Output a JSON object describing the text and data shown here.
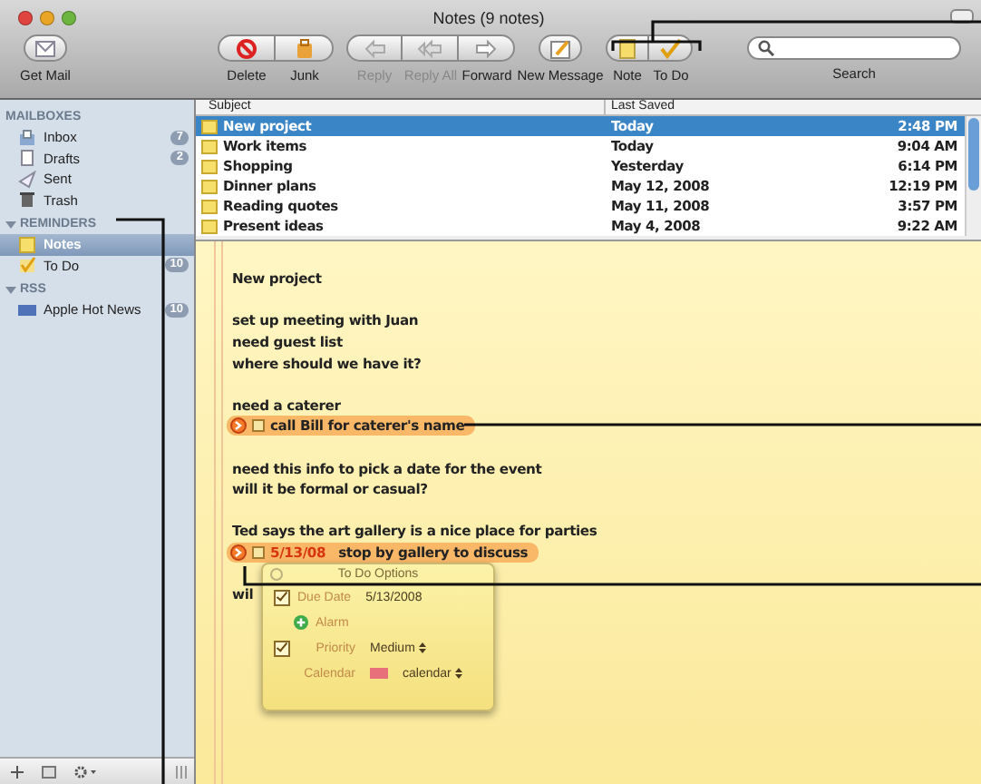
{
  "window": {
    "title": "Notes (9 notes)"
  },
  "toolbar": {
    "groups": [
      {
        "buttons": [
          {
            "label": "Get Mail",
            "disabled": false
          }
        ]
      },
      {
        "buttons": [
          {
            "label": "Delete",
            "disabled": false
          },
          {
            "label": "Junk",
            "disabled": false
          }
        ]
      },
      {
        "buttons": [
          {
            "label": "Reply",
            "disabled": true
          },
          {
            "label": "Reply All",
            "disabled": true
          },
          {
            "label": "Forward",
            "disabled": false
          }
        ]
      },
      {
        "buttons": [
          {
            "label": "New Message",
            "disabled": false
          }
        ]
      },
      {
        "buttons": [
          {
            "label": "Note",
            "disabled": false
          },
          {
            "label": "To Do",
            "disabled": false
          }
        ]
      }
    ],
    "search": {
      "label": "Search"
    }
  },
  "sidebar": {
    "sections": [
      {
        "title": "MAILBOXES",
        "kind": "plain",
        "items": [
          {
            "name": "Inbox",
            "badge": "7",
            "selected": false
          },
          {
            "name": "Drafts",
            "badge": "2",
            "selected": false
          },
          {
            "name": "Sent",
            "selected": false
          },
          {
            "name": "Trash",
            "selected": false
          }
        ]
      },
      {
        "title": "REMINDERS",
        "kind": "disclosure",
        "items": [
          {
            "name": "Notes",
            "selected": true
          },
          {
            "name": "To Do",
            "badge": "10",
            "selected": false
          }
        ]
      },
      {
        "title": "RSS",
        "kind": "disclosure",
        "items": [
          {
            "name": "Apple Hot News",
            "badge": "10",
            "selected": false
          }
        ]
      }
    ]
  },
  "list": {
    "columns": [
      "Subject",
      "Last Saved"
    ],
    "rows": [
      {
        "subject": "New project",
        "date": "Today",
        "time": "2:48 PM",
        "selected": true
      },
      {
        "subject": "Work items",
        "date": "Today",
        "time": "9:04 AM",
        "selected": false
      },
      {
        "subject": "Shopping",
        "date": "Yesterday",
        "time": "6:14 PM",
        "selected": false
      },
      {
        "subject": "Dinner plans",
        "date": "May 12, 2008",
        "time": "12:19 PM",
        "selected": false
      },
      {
        "subject": "Reading quotes",
        "date": "May 11, 2008",
        "time": "3:57 PM",
        "selected": false
      },
      {
        "subject": "Present ideas",
        "date": "May 4, 2008",
        "time": "9:22 AM",
        "selected": false
      }
    ]
  },
  "note": {
    "lines": [
      {
        "kind": "text",
        "text": "New project"
      },
      {
        "kind": "blank"
      },
      {
        "kind": "text",
        "text": "set up meeting with Juan"
      },
      {
        "kind": "text",
        "text": "need guest list"
      },
      {
        "kind": "text",
        "text": "where should we have it?"
      },
      {
        "kind": "blank"
      },
      {
        "kind": "text",
        "text": "need a caterer"
      },
      {
        "kind": "todo",
        "text": "call Bill for caterer's name",
        "checked": false
      },
      {
        "kind": "blank"
      },
      {
        "kind": "text",
        "text": "need this info to pick a date for the event"
      },
      {
        "kind": "text",
        "text": "will it be formal or casual?"
      },
      {
        "kind": "blank"
      },
      {
        "kind": "text",
        "text": "Ted says the art gallery is a nice place for parties"
      },
      {
        "kind": "todo",
        "date": "5/13/08",
        "text": "stop by gallery to discuss",
        "checked": false
      },
      {
        "kind": "blank"
      },
      {
        "kind": "text",
        "text": "wil"
      }
    ]
  },
  "todo_options": {
    "title": "To Do Options",
    "due_date": {
      "label": "Due Date",
      "value": "5/13/2008",
      "checked": true
    },
    "alarm": {
      "label": "Alarm"
    },
    "priority": {
      "label": "Priority",
      "value": "Medium",
      "checked": true
    },
    "calendar": {
      "label": "Calendar",
      "value": "calendar",
      "color": "#e8707a"
    }
  }
}
